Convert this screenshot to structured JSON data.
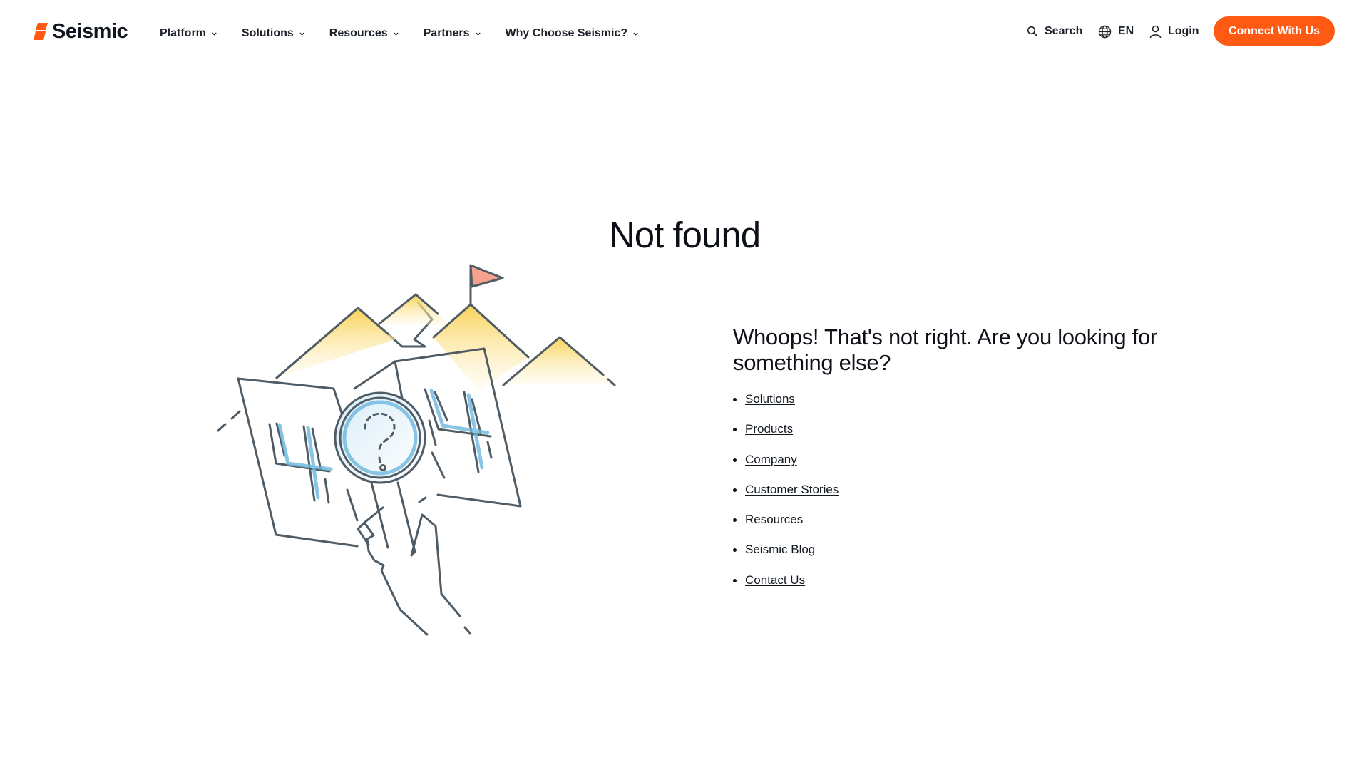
{
  "brand": {
    "name": "Seismic",
    "accent": "#ff5a14"
  },
  "nav": {
    "items": [
      {
        "label": "Platform"
      },
      {
        "label": "Solutions"
      },
      {
        "label": "Resources"
      },
      {
        "label": "Partners"
      },
      {
        "label": "Why Choose Seismic?"
      }
    ]
  },
  "tools": {
    "search_label": "Search",
    "language_label": "EN",
    "login_label": "Login",
    "cta_label": "Connect With Us"
  },
  "main": {
    "title": "Not found",
    "illustration_label": "404",
    "message": "Whoops! That's not right. Are you looking for something else?",
    "links": [
      {
        "label": "Solutions"
      },
      {
        "label": "Products"
      },
      {
        "label": "Company"
      },
      {
        "label": "Customer Stories"
      },
      {
        "label": "Resources"
      },
      {
        "label": "Seismic Blog"
      },
      {
        "label": "Contact Us"
      }
    ]
  }
}
